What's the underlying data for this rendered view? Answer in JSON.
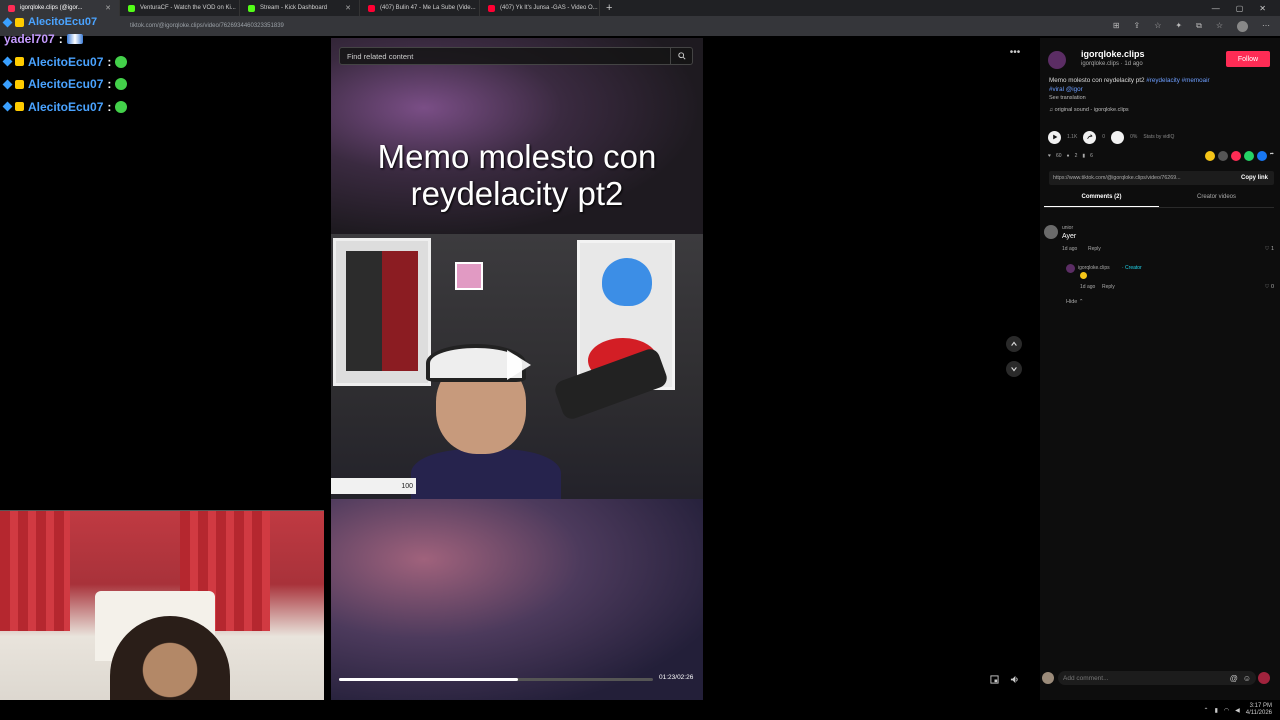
{
  "browser": {
    "tabs": [
      {
        "label": "igorqloke.clips (@igor...",
        "favicon": "#fe2c55",
        "active": true
      },
      {
        "label": "VenturaCF - Watch the VOD on Ki...",
        "favicon": "#53fc18",
        "active": false
      },
      {
        "label": "Stream - Kick Dashboard",
        "favicon": "#53fc18",
        "active": false
      },
      {
        "label": "(407) Bulin 47 - Me La Sube (Vide...",
        "favicon": "#ff0033",
        "active": false
      },
      {
        "label": "(407) Yk It's Junsa -GAS - Video O...",
        "favicon": "#ff0033",
        "active": false
      }
    ],
    "new_tab": "+",
    "url": "tiktok.com/@igorqloke.clips/video/7626934460323351839"
  },
  "chat": [
    {
      "user": "yadel707",
      "color": "purple",
      "sep": ":",
      "emote": "flag"
    },
    {
      "user": "AlecitoEcu07",
      "color": "blue",
      "sep": ":",
      "emote": "green"
    },
    {
      "user": "AlecitoEcu07",
      "color": "blue",
      "sep": ":",
      "emote": "green"
    },
    {
      "user": "AlecitoEcu07",
      "color": "blue",
      "sep": ":",
      "emote": "green"
    }
  ],
  "chat_top_user": "AlecitoEcu07",
  "video": {
    "search_placeholder": "Find related content",
    "title": "Memo molesto con reydelacity pt2",
    "volume_label": "100",
    "time": "01:23/02:26",
    "progress": 0.57
  },
  "panel": {
    "author": "igorqloke.clips",
    "author_sub": "igorqloke.clips · 1d ago",
    "follow_label": "Follow",
    "description_text": "Memo molesto con reydelacity pt2 ",
    "hashtags": [
      "#reydelacity",
      "#memoair",
      "#viral",
      "@igor"
    ],
    "see_translation": "See translation",
    "sound": "♫ original sound - igorqloke.clips",
    "stats": [
      "1.1K",
      "0",
      "0%",
      "Stats by vidIQ"
    ],
    "actions": [
      "60",
      "2",
      "6"
    ],
    "link": "https://www.tiktok.com/@igorqloke.clips/video/76269...",
    "copy_link": "Copy link",
    "tab_comments": "Comments (2)",
    "tab_creator": "Creator videos",
    "comments": [
      {
        "user": "unior",
        "text": "Ayer",
        "meta": "1d ago",
        "reply_label": "Reply",
        "likes": "1"
      }
    ],
    "reply": {
      "user": "igorqloke.clips",
      "creator_tag": "· Creator",
      "meta": "1d ago",
      "reply_label": "Reply",
      "likes": "0"
    },
    "hide_label": "Hide",
    "add_comment_placeholder": "Add comment..."
  },
  "taskbar": {
    "time": "3:17 PM",
    "date": "4/11/2026"
  }
}
